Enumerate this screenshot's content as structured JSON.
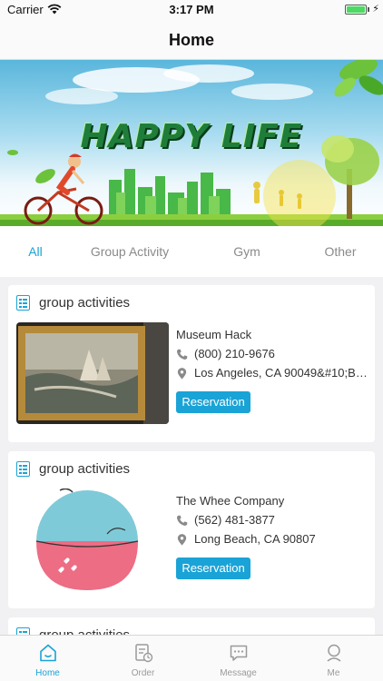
{
  "status_bar": {
    "carrier": "Carrier",
    "time": "3:17 PM"
  },
  "nav": {
    "title": "Home"
  },
  "banner": {
    "headline": "HAPPY LIFE"
  },
  "tabs": [
    {
      "label": "All",
      "active": true
    },
    {
      "label": "Group Activity",
      "active": false
    },
    {
      "label": "Gym",
      "active": false
    },
    {
      "label": "Other",
      "active": false
    }
  ],
  "cards": [
    {
      "category": "group activities",
      "name": "Museum Hack",
      "phone": "(800) 210-9676",
      "address": "Los Angeles, CA 90049&#10;Bro...",
      "button": "Reservation",
      "image_icon": "painting-image"
    },
    {
      "category": "group activities",
      "name": "The Whee Company",
      "phone": "(562) 481-3877",
      "address": "Long Beach, CA 90807",
      "button": "Reservation",
      "image_icon": "umbrella-logo-image"
    },
    {
      "category": "group activities"
    }
  ],
  "tab_bar": [
    {
      "label": "Home",
      "icon": "home-icon",
      "active": true
    },
    {
      "label": "Order",
      "icon": "order-icon",
      "active": false
    },
    {
      "label": "Message",
      "icon": "message-icon",
      "active": false
    },
    {
      "label": "Me",
      "icon": "profile-icon",
      "active": false
    }
  ],
  "colors": {
    "accent": "#1aa3d6",
    "battery": "#4cd964"
  }
}
